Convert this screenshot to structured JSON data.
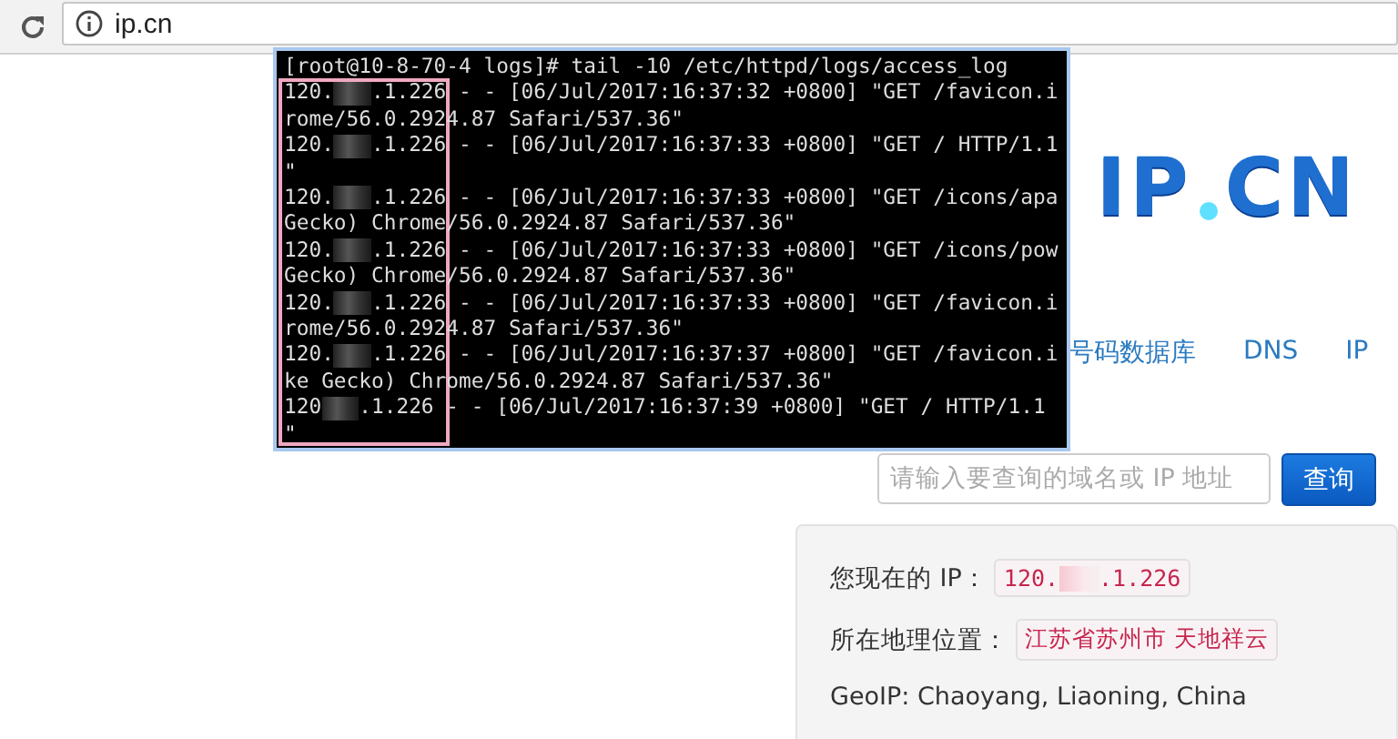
{
  "browser": {
    "address": "ip.cn"
  },
  "terminal": {
    "prompt": "[root@10-8-70-4 logs]# tail -10 /etc/httpd/logs/access_log",
    "lines": [
      {
        "kind": "request",
        "ip_prefix": "120.",
        "ip_suffix": ".1.226",
        "text": " - - [06/Jul/2017:16:37:32 +0800] \"GET /favicon.i"
      },
      {
        "kind": "text",
        "text": "rome/56.0.2924.87 Safari/537.36\""
      },
      {
        "kind": "request",
        "ip_prefix": "120.",
        "ip_suffix": ".1.226",
        "text": " - - [06/Jul/2017:16:37:33 +0800] \"GET / HTTP/1.1"
      },
      {
        "kind": "text",
        "text": "\""
      },
      {
        "kind": "request",
        "ip_prefix": "120.",
        "ip_suffix": ".1.226",
        "text": " - - [06/Jul/2017:16:37:33 +0800] \"GET /icons/apa"
      },
      {
        "kind": "text",
        "text": "Gecko) Chrome/56.0.2924.87 Safari/537.36\""
      },
      {
        "kind": "request",
        "ip_prefix": "120.",
        "ip_suffix": ".1.226",
        "text": " - - [06/Jul/2017:16:37:33 +0800] \"GET /icons/pow"
      },
      {
        "kind": "text",
        "text": "Gecko) Chrome/56.0.2924.87 Safari/537.36\""
      },
      {
        "kind": "request",
        "ip_prefix": "120.",
        "ip_suffix": ".1.226",
        "text": " - - [06/Jul/2017:16:37:33 +0800] \"GET /favicon.i"
      },
      {
        "kind": "text",
        "text": "rome/56.0.2924.87 Safari/537.36\""
      },
      {
        "kind": "request",
        "ip_prefix": "120.",
        "ip_suffix": ".1.226",
        "text": " - - [06/Jul/2017:16:37:37 +0800] \"GET /favicon.i"
      },
      {
        "kind": "text",
        "text": "ke Gecko) Chrome/56.0.2924.87 Safari/537.36\""
      },
      {
        "kind": "request",
        "ip_prefix": "120",
        "ip_suffix": ".1.226",
        "text": " - - [06/Jul/2017:16:37:39 +0800] \"GET / HTTP/1.1"
      },
      {
        "kind": "text",
        "text": "\""
      }
    ]
  },
  "logo": {
    "text": "IP",
    "suffix": "CN"
  },
  "nav": [
    {
      "label": "号码数据库"
    },
    {
      "label": "DNS"
    },
    {
      "label": "IP"
    }
  ],
  "search": {
    "placeholder": "请输入要查询的域名或 IP 地址",
    "button": "查询"
  },
  "info": {
    "ip_label": "您现在的 IP：",
    "ip_prefix": "120.",
    "ip_suffix": ".1.226",
    "location_label": "所在地理位置：",
    "location": "江苏省苏州市 天地祥云",
    "geoip": "GeoIP: Chaoyang, Liaoning, China"
  }
}
